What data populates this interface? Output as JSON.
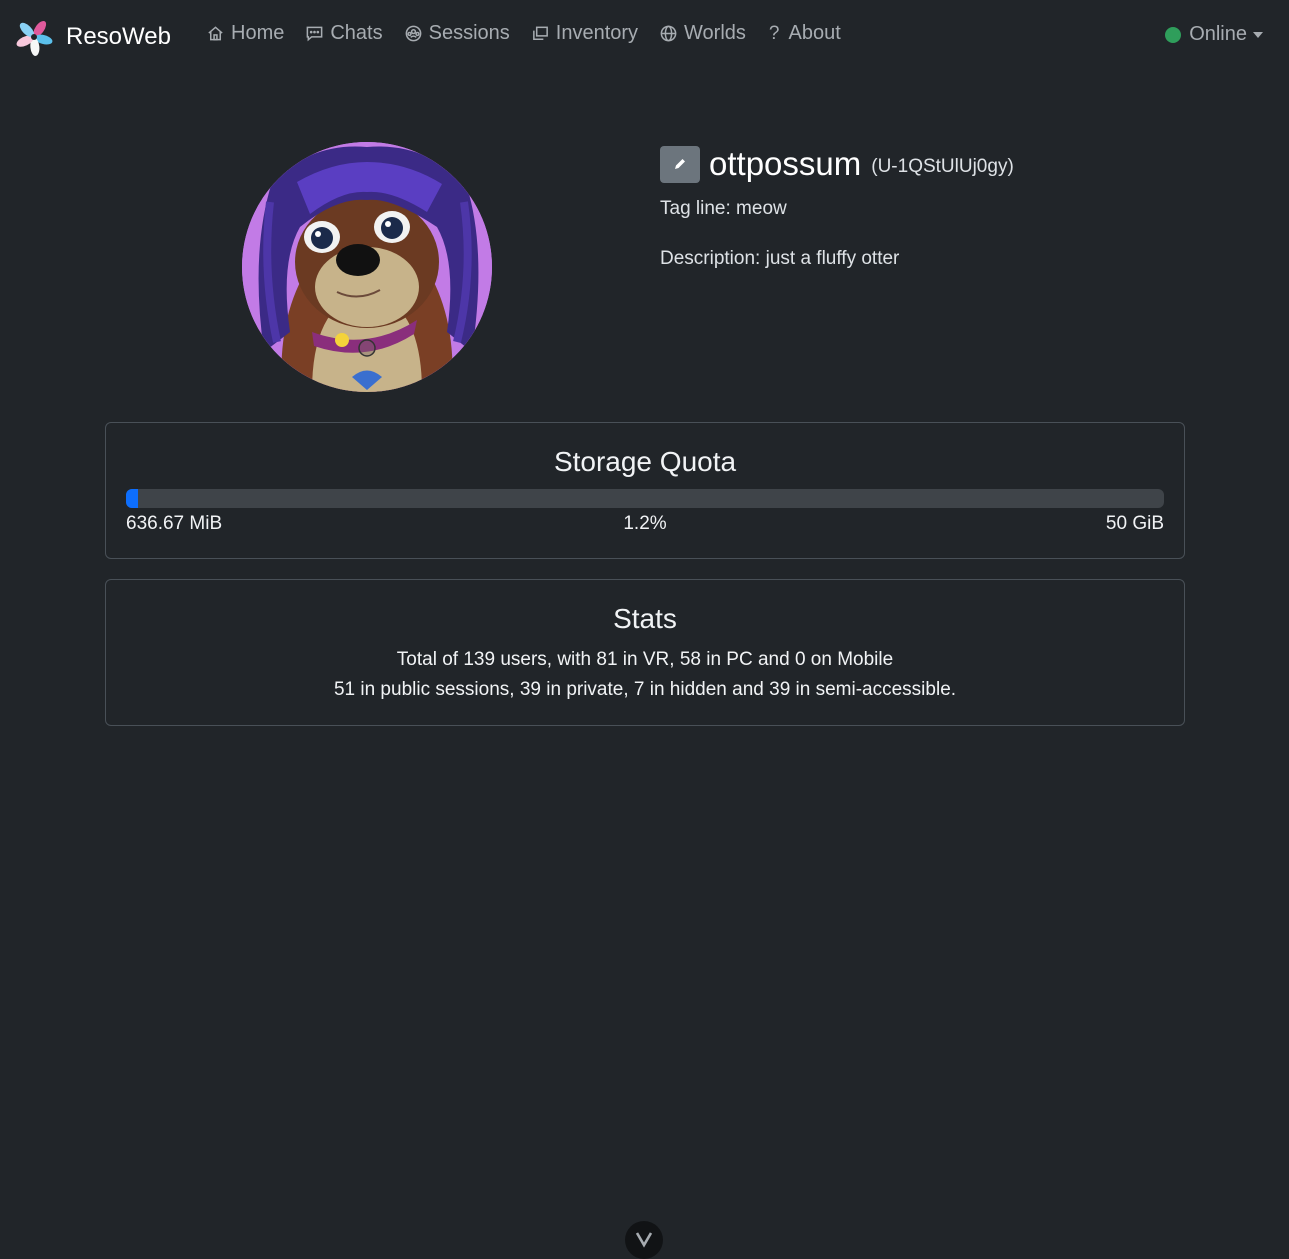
{
  "navbar": {
    "brand": "ResoWeb",
    "items": [
      {
        "label": "Home",
        "icon": "home-icon"
      },
      {
        "label": "Chats",
        "icon": "chat-icon"
      },
      {
        "label": "Sessions",
        "icon": "sessions-icon"
      },
      {
        "label": "Inventory",
        "icon": "inventory-icon"
      },
      {
        "label": "Worlds",
        "icon": "globe-icon"
      },
      {
        "label": "About",
        "icon": "question-icon"
      }
    ],
    "status": {
      "label": "Online",
      "color": "#2f9e5b"
    }
  },
  "profile": {
    "username": "ottpossum",
    "user_id": "(U-1QStUlUj0gy)",
    "tagline": "Tag line: meow",
    "description": "Description: just a fluffy otter"
  },
  "storage": {
    "title": "Storage Quota",
    "used": "636.67 MiB",
    "percent_label": "1.2%",
    "percent_value": 1.2,
    "total": "50 GiB"
  },
  "stats": {
    "title": "Stats",
    "line1": "Total of 139 users, with 81 in VR, 58 in PC and 0 on Mobile",
    "line2": "51 in public sessions, 39 in private, 7 in hidden and 39 in semi-accessible."
  },
  "colors": {
    "background": "#212529",
    "accent": "#0d6efd",
    "avatar_bg": "#c27be6"
  }
}
